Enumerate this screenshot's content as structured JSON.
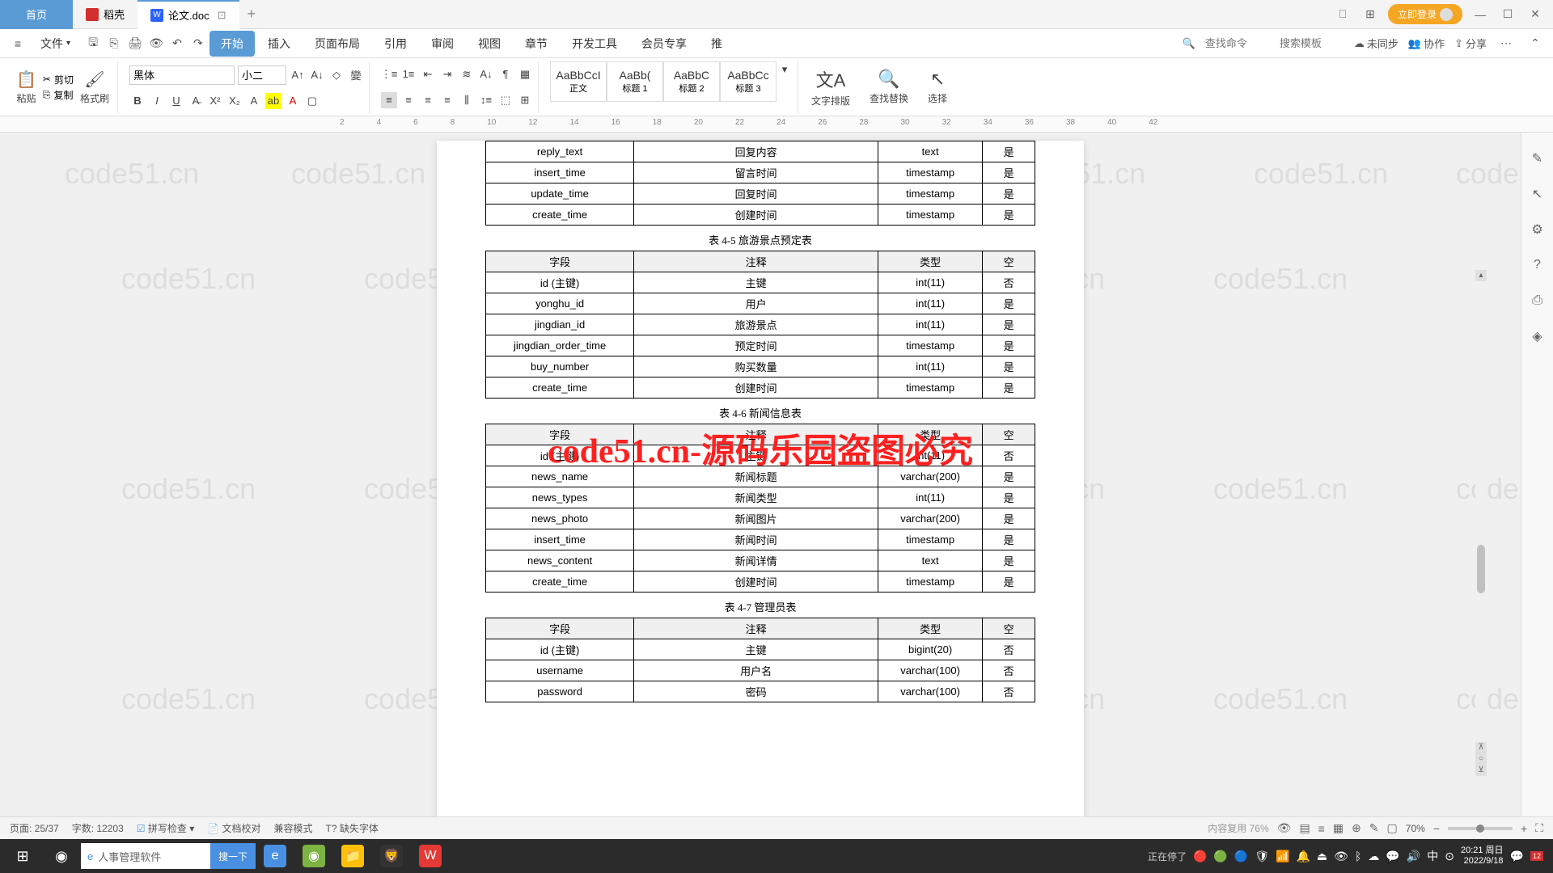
{
  "tabs": {
    "home": "首页",
    "t1": "稻壳",
    "t2": "论文.doc",
    "add": "+"
  },
  "topRight": {
    "login": "立即登录"
  },
  "menu": {
    "file": "文件",
    "items": [
      "开始",
      "插入",
      "页面布局",
      "引用",
      "审阅",
      "视图",
      "章节",
      "开发工具",
      "会员专享",
      "推"
    ],
    "searchCmd": "查找命令",
    "searchTpl": "搜索模板",
    "unsync": "未同步",
    "collab": "协作",
    "share": "分享"
  },
  "ribbon": {
    "paste": "粘贴",
    "cut": "剪切",
    "copy": "复制",
    "format": "格式刷",
    "fontName": "黑体",
    "fontSize": "小二",
    "styles": [
      {
        "preview": "AaBbCcI",
        "name": "正文"
      },
      {
        "preview": "AaBb(",
        "name": "标题 1"
      },
      {
        "preview": "AaBbC",
        "name": "标题 2"
      },
      {
        "preview": "AaBbCc",
        "name": "标题 3"
      }
    ],
    "textLayout": "文字排版",
    "findReplace": "查找替换",
    "select": "选择"
  },
  "tables": [
    {
      "caption": "",
      "header": null,
      "rows": [
        [
          "reply_text",
          "回复内容",
          "text",
          "是"
        ],
        [
          "insert_time",
          "留言时间",
          "timestamp",
          "是"
        ],
        [
          "update_time",
          "回复时间",
          "timestamp",
          "是"
        ],
        [
          "create_time",
          "创建时间",
          "timestamp",
          "是"
        ]
      ]
    },
    {
      "caption": "表 4-5 旅游景点预定表",
      "header": [
        "字段",
        "注释",
        "类型",
        "空"
      ],
      "rows": [
        [
          "id (主键)",
          "主键",
          "int(11)",
          "否"
        ],
        [
          "yonghu_id",
          "用户",
          "int(11)",
          "是"
        ],
        [
          "jingdian_id",
          "旅游景点",
          "int(11)",
          "是"
        ],
        [
          "jingdian_order_time",
          "预定时间",
          "timestamp",
          "是"
        ],
        [
          "buy_number",
          "购买数量",
          "int(11)",
          "是"
        ],
        [
          "create_time",
          "创建时间",
          "timestamp",
          "是"
        ]
      ]
    },
    {
      "caption": "表 4-6 新闻信息表",
      "header": [
        "字段",
        "注释",
        "类型",
        "空"
      ],
      "rows": [
        [
          "id (主键)",
          "主键",
          "int(11)",
          "否"
        ],
        [
          "news_name",
          "新闻标题",
          "varchar(200)",
          "是"
        ],
        [
          "news_types",
          "新闻类型",
          "int(11)",
          "是"
        ],
        [
          "news_photo",
          "新闻图片",
          "varchar(200)",
          "是"
        ],
        [
          "insert_time",
          "新闻时间",
          "timestamp",
          "是"
        ],
        [
          "news_content",
          "新闻详情",
          "text",
          "是"
        ],
        [
          "create_time",
          "创建时间",
          "timestamp",
          "是"
        ]
      ]
    },
    {
      "caption": "表 4-7 管理员表",
      "header": [
        "字段",
        "注释",
        "类型",
        "空"
      ],
      "rows": [
        [
          "id (主键)",
          "主键",
          "bigint(20)",
          "否"
        ],
        [
          "username",
          "用户名",
          "varchar(100)",
          "否"
        ],
        [
          "password",
          "密码",
          "varchar(100)",
          "否"
        ]
      ]
    }
  ],
  "redText": "code51.cn-源码乐园盗图必究",
  "watermark": "code51.cn",
  "status": {
    "page": "页面: 25/37",
    "words": "字数: 12203",
    "spell": "拼写检查",
    "proofread": "文档校对",
    "compat": "兼容模式",
    "missing": "缺失字体",
    "zoom": "70%",
    "overlay": "内容复用 76%"
  },
  "taskbar": {
    "searchPlaceholder": "人事管理软件",
    "searchBtn": "搜一下",
    "time": "20:21",
    "day": "周日",
    "date": "2022/9/18"
  }
}
